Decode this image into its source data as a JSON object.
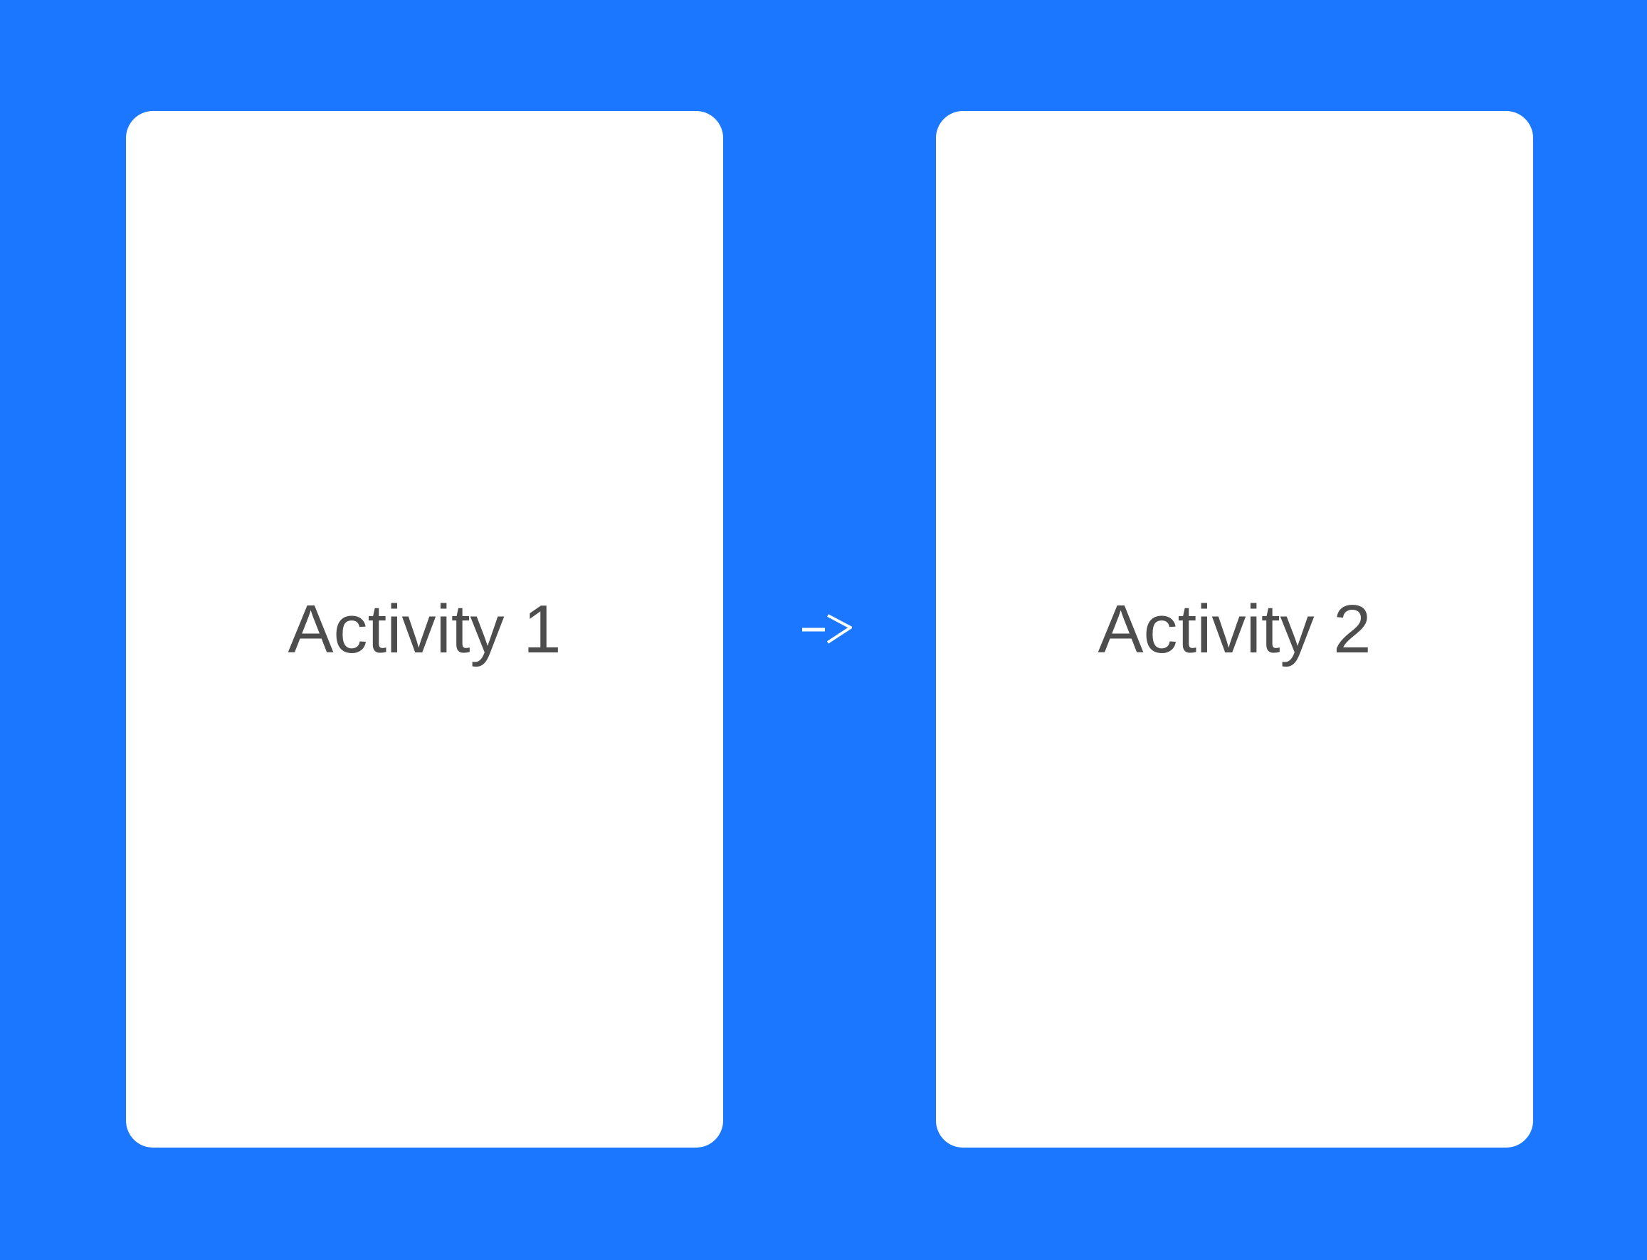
{
  "background_color": "#1B77FF",
  "card_color": "#FFFFFF",
  "text_color": "#4D4D4D",
  "activities": [
    {
      "label": "Activity 1"
    },
    {
      "label": "Activity 2"
    }
  ],
  "connector": {
    "icon": "arrow-right-icon",
    "color": "#FFFFFF"
  }
}
